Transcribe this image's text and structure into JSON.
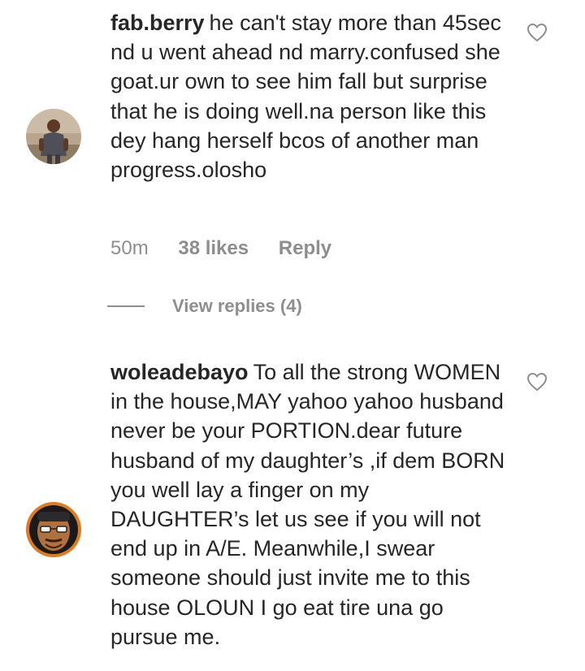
{
  "comments": [
    {
      "username": "fab.berry",
      "text": "he can't stay more than 45sec nd u went ahead nd marry.confused she goat.ur own to see him fall but surprise that he is doing well.na person like this dey hang herself bcos of another man progress.olosho",
      "time": "50m",
      "likes": "38 likes",
      "reply": "Reply",
      "view_replies": "View replies (4)",
      "avatar_icon": "user-avatar-photo",
      "like_icon": "heart-outline-icon"
    },
    {
      "username": "woleadebayo",
      "text": "To all the strong WOMEN in the house,MAY yahoo yahoo husband never be your PORTION.dear future husband of my daughter’s ,if dem BORN you well lay a finger on my DAUGHTER’s let us see if you will not end up in A/E. Meanwhile,I swear someone should just invite me to this house OLOUN I go eat tire una go pursue me.",
      "avatar_icon": "user-avatar-cartoon",
      "like_icon": "heart-outline-icon"
    }
  ],
  "colors": {
    "text": "#262626",
    "secondary": "#8e8e8e",
    "background": "#ffffff"
  }
}
